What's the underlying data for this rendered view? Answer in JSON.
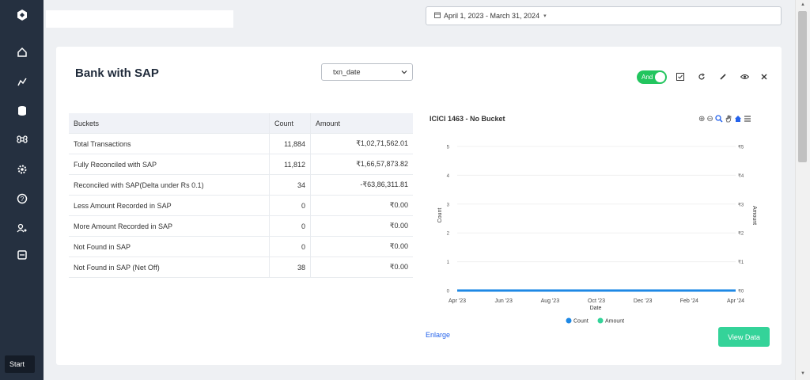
{
  "sidebar": {
    "icons": [
      "logo-icon",
      "home-icon",
      "analytics-icon",
      "database-icon",
      "command-icon",
      "settings-icon",
      "help-icon",
      "users-icon",
      "report-icon"
    ],
    "start_label": "Start"
  },
  "header": {
    "date_range": "April 1, 2023 - March 31, 2024"
  },
  "card": {
    "title": "Bank with SAP",
    "select_value": "txn_date",
    "toggle_label": "And",
    "table": {
      "headers": [
        "Buckets",
        "Count",
        "Amount"
      ],
      "rows": [
        {
          "bucket": "Total Transactions",
          "count": "11,884",
          "amount": "₹1,02,71,562.01"
        },
        {
          "bucket": "Fully Reconciled with SAP",
          "count": "11,812",
          "amount": "₹1,66,57,873.82"
        },
        {
          "bucket": "Reconciled with SAP(Delta under Rs 0.1)",
          "count": "34",
          "amount": "-₹63,86,311.81"
        },
        {
          "bucket": "Less Amount Recorded in SAP",
          "count": "0",
          "amount": "₹0.00"
        },
        {
          "bucket": "More Amount Recorded in SAP",
          "count": "0",
          "amount": "₹0.00"
        },
        {
          "bucket": "Not Found in SAP",
          "count": "0",
          "amount": "₹0.00"
        },
        {
          "bucket": "Not Found in SAP (Net Off)",
          "count": "38",
          "amount": "₹0.00"
        }
      ]
    },
    "enlarge_label": "Enlarge",
    "view_data_label": "View Data"
  },
  "colors": {
    "count": "#1e88e5",
    "amount": "#34d399"
  },
  "chart_data": {
    "type": "line",
    "title": "ICICI 1463 - No Bucket",
    "xlabel": "Date",
    "ylabel": "Count",
    "y2label": "Amount",
    "x_ticks": [
      "Apr '23",
      "Jun '23",
      "Aug '23",
      "Oct '23",
      "Dec '23",
      "Feb '24",
      "Apr '24"
    ],
    "y_ticks": [
      "0",
      "1",
      "2",
      "3",
      "4",
      "5"
    ],
    "y2_ticks": [
      "₹0",
      "₹1",
      "₹2",
      "₹3",
      "₹4",
      "₹5"
    ],
    "ylim": [
      0,
      5
    ],
    "series": [
      {
        "name": "Count",
        "x": [
          "Apr '23",
          "Apr '24"
        ],
        "values": [
          0,
          0
        ]
      },
      {
        "name": "Amount",
        "x": [
          "Apr '23",
          "Apr '24"
        ],
        "values": [
          0,
          0
        ]
      }
    ],
    "legend": "bottom",
    "grid": true
  }
}
